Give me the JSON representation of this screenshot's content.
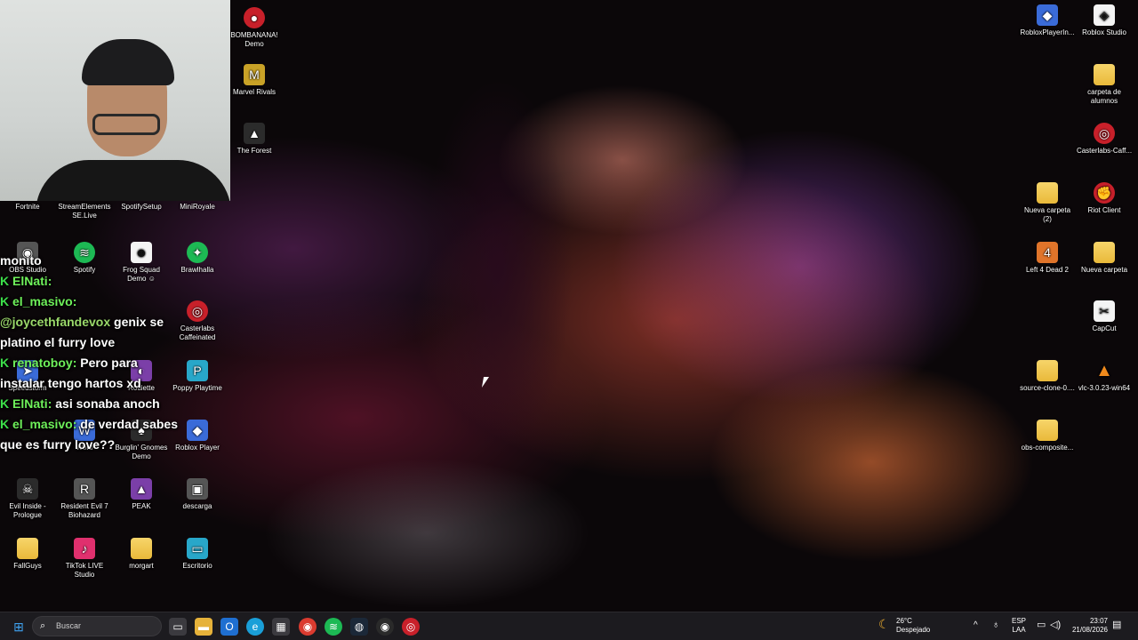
{
  "desktop_icons": {
    "bombanana": {
      "label": "BOMBANANA! Demo",
      "icon": "bombanana-icon"
    },
    "marvel_rivals": {
      "label": "Marvel Rivals",
      "icon": "marvel-rivals-icon"
    },
    "the_forest": {
      "label": "The Forest",
      "icon": "the-forest-icon"
    },
    "fortnite": {
      "label": "Fortnite",
      "icon": "fortnite-icon"
    },
    "streamelements": {
      "label": "StreamElements SE.Live",
      "icon": "streamelements-icon"
    },
    "spotifysetup": {
      "label": "SpotifySetup",
      "icon": "spotify-setup-icon"
    },
    "miniroyale": {
      "label": "MiniRoyale",
      "icon": "miniroyale-icon"
    },
    "obs_studio": {
      "label": "OBS Studio",
      "icon": "obs-icon"
    },
    "spotify": {
      "label": "Spotify",
      "icon": "spotify-icon"
    },
    "frog_squad": {
      "label": "Frog Squad Demo ☺",
      "icon": "frog-squad-icon"
    },
    "brawlhalla": {
      "label": "Brawlhalla",
      "icon": "brawlhalla-icon"
    },
    "casterlabs": {
      "label": "Casterlabs Caffeinated",
      "icon": "casterlabs-icon"
    },
    "speedstorm": {
      "label": "Speedstorm",
      "icon": "speedstorm-icon"
    },
    "roulette": {
      "label": "Roulette",
      "icon": "roulette-icon"
    },
    "poppy_playtime": {
      "label": "Poppy Playtime",
      "icon": "poppy-playtime-icon"
    },
    "word": {
      "label": "Word",
      "icon": "word-icon"
    },
    "burglin_gnomes": {
      "label": "Burglin' Gnomes Demo",
      "icon": "burglin-gnomes-icon"
    },
    "roblox_player": {
      "label": "Roblox Player",
      "icon": "roblox-icon"
    },
    "evil_inside": {
      "label": "Evil Inside - Prologue",
      "icon": "evil-inside-icon"
    },
    "resident_evil": {
      "label": "Resident Evil 7 Biohazard",
      "icon": "resident-evil-icon"
    },
    "peak": {
      "label": "PEAK",
      "icon": "peak-icon"
    },
    "descarga": {
      "label": "descarga",
      "icon": "download-image-icon"
    },
    "fallguys": {
      "label": "FallGuys",
      "icon": "folder-icon"
    },
    "tiktok_live": {
      "label": "TikTok LIVE Studio",
      "icon": "tiktok-icon"
    },
    "morgart": {
      "label": "morgart",
      "icon": "folder-icon"
    },
    "escritorio": {
      "label": "Escritorio",
      "icon": "desktop-shortcut-icon"
    },
    "roblox_player_installer": {
      "label": "RobloxPlayerIn...",
      "icon": "roblox-installer-icon"
    },
    "roblox_studio": {
      "label": "Roblox Studio",
      "icon": "roblox-studio-icon"
    },
    "carpeta_alumnos": {
      "label": "carpeta de alumnos",
      "icon": "folder-icon"
    },
    "casterlabs_caff": {
      "label": "Casterlabs-Caff...",
      "icon": "casterlabs-icon"
    },
    "nueva_carpeta_2": {
      "label": "Nueva carpeta (2)",
      "icon": "folder-icon"
    },
    "riot_client": {
      "label": "Riot Client",
      "icon": "riot-client-icon"
    },
    "left4dead": {
      "label": "Left 4 Dead 2",
      "icon": "left4dead-icon"
    },
    "nueva_carpeta": {
      "label": "Nueva carpeta",
      "icon": "folder-icon"
    },
    "capcut": {
      "label": "CapCut",
      "icon": "capcut-icon"
    },
    "source_clone": {
      "label": "source-clone-0....",
      "icon": "folder-icon"
    },
    "vlc": {
      "label": "vlc-3.0.23-win64",
      "icon": "vlc-icon"
    },
    "obs_composite": {
      "label": "obs-composite...",
      "icon": "folder-icon"
    }
  },
  "chat": [
    {
      "user": "",
      "text": "monito"
    },
    {
      "badge": "K",
      "user": "ElNati:",
      "text": ""
    },
    {
      "badge": "K",
      "user": "el_masivo:",
      "text": ""
    },
    {
      "mention": "@joycethfandevox",
      "text": " genix se platino el furry love"
    },
    {
      "badge": "K",
      "user": "renatoboy:",
      "text": " Pero para instalar tengo hartos xd"
    },
    {
      "badge": "K",
      "user": "ElNati:",
      "text": " asi sonaba anoch"
    },
    {
      "badge": "K",
      "user": "el_masivo:",
      "text": " de verdad sabes que es furry love??"
    }
  ],
  "taskbar": {
    "search_placeholder": "Buscar",
    "weather_temp": "26°C",
    "weather_desc": "Despejado",
    "lang_top": "ESP",
    "lang_bottom": "LAA",
    "time": "23:07",
    "date": "21/08/2026"
  }
}
